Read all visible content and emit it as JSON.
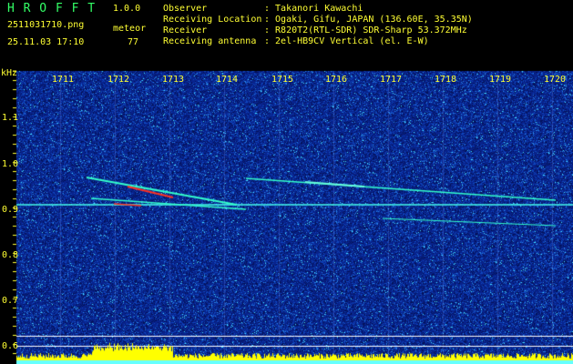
{
  "app": {
    "name": "H R O F F T",
    "version": "1.0.0"
  },
  "header": {
    "filename": "2511031710.png",
    "datetime": "25.11.03 17:10",
    "detection_label": "meteor",
    "detection_count": "77",
    "fields": [
      {
        "label": "Observer",
        "value": ": Takanori Kawachi"
      },
      {
        "label": "Receiving Location",
        "value": ": Ogaki, Gifu, JAPAN (136.60E, 35.35N)"
      },
      {
        "label": "Receiver",
        "value": ": R820T2(RTL-SDR) SDR-Sharp 53.372MHz"
      },
      {
        "label": "Receiving antenna",
        "value": ": 2el-HB9CV Vertical (el. E-W)"
      }
    ]
  },
  "axes": {
    "y_unit": "kHz",
    "y_ticks": [
      "1.1",
      "1.0",
      "0.9",
      "0.8",
      "0.7",
      "0.6"
    ],
    "x_ticks": [
      "1711",
      "1712",
      "1713",
      "1714",
      "1715",
      "1716",
      "1717",
      "1718",
      "1719",
      "1720"
    ]
  },
  "colors": {
    "background": "#000000",
    "header_green": "#33ff66",
    "header_yellow": "#ffff33",
    "spectrogram_base": "#0a2a8a",
    "echo_cyan": "#33ffdd",
    "echo_red": "#ff3322",
    "histogram": "#ffff00"
  }
}
